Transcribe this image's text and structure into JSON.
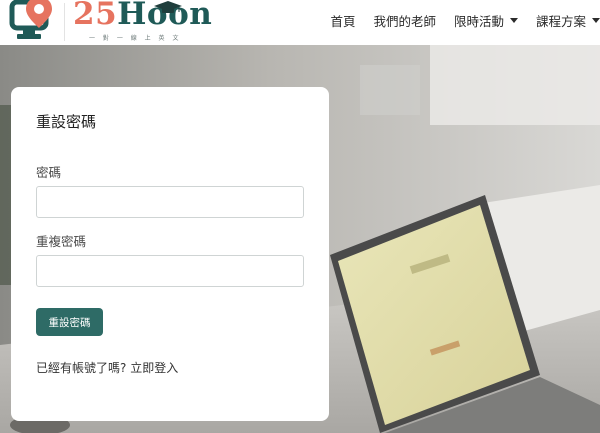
{
  "brand": {
    "name_num": "25",
    "name_word": "Hoon",
    "tagline": "一 對 一 線 上 英 文",
    "primary_color": "#1f5a57",
    "accent_color": "#e6735f"
  },
  "nav": {
    "items": [
      {
        "label": "首頁",
        "dropdown": false
      },
      {
        "label": "我們的老師",
        "dropdown": false
      },
      {
        "label": "限時活動",
        "dropdown": true
      },
      {
        "label": "課程方案",
        "dropdown": true
      }
    ]
  },
  "form": {
    "title": "重設密碼",
    "password_label": "密碼",
    "password_value": "",
    "confirm_label": "重複密碼",
    "confirm_value": "",
    "submit_label": "重設密碼",
    "login_prompt": "已經有帳號了嗎?",
    "login_link": "立即登入",
    "button_color": "#2e6b66"
  }
}
